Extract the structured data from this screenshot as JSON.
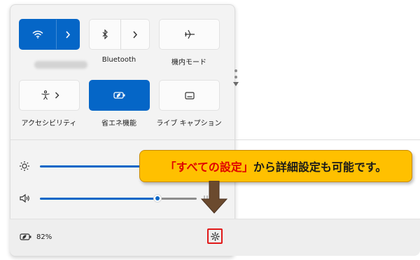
{
  "quick_settings": {
    "tiles": [
      {
        "id": "wifi",
        "icon": "wifi-icon",
        "label": "",
        "label_blurred": true,
        "state": "on",
        "split": true
      },
      {
        "id": "bluetooth",
        "icon": "bluetooth-icon",
        "label": "Bluetooth",
        "state": "off",
        "split": true
      },
      {
        "id": "airplane",
        "icon": "airplane-icon",
        "label": "機内モード",
        "state": "off",
        "split": false
      },
      {
        "id": "accessibility",
        "icon": "accessibility-icon",
        "label": "アクセシビリティ",
        "state": "off",
        "split": true
      },
      {
        "id": "energy",
        "icon": "energy-saver-icon",
        "label": "省エネ機能",
        "state": "on",
        "split": false
      },
      {
        "id": "captions",
        "icon": "live-captions-icon",
        "label": "ライブ キャプション",
        "state": "off",
        "split": false
      }
    ],
    "sliders": [
      {
        "id": "brightness",
        "icon": "brightness-icon",
        "level": 0.74
      },
      {
        "id": "volume",
        "icon": "speaker-icon",
        "level": 0.7
      }
    ],
    "footer": {
      "battery_icon": "battery-saver-icon",
      "battery_text": "82%",
      "settings_icon": "gear-icon"
    }
  },
  "annotation": {
    "emphasis": "「すべての設定」",
    "rest": "から詳細設定も可能です。"
  },
  "colors": {
    "accent": "#0566c7",
    "callout_bg": "#ffc000",
    "highlight_red": "#e11919",
    "emphasis_text": "#e00000"
  }
}
